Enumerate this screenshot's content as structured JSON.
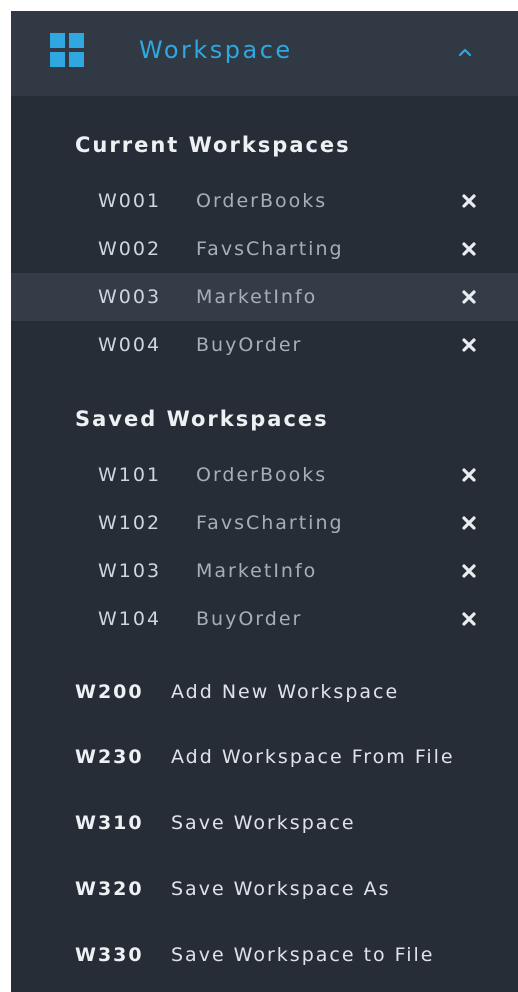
{
  "header": {
    "title": "Workspace",
    "icon": "grid-icon",
    "toggle_icon": "chevron-up-icon",
    "accent": "#2fa7e0"
  },
  "current": {
    "title": "Current Workspaces",
    "items": [
      {
        "id": "W001",
        "name": "OrderBooks"
      },
      {
        "id": "W002",
        "name": "FavsCharting"
      },
      {
        "id": "W003",
        "name": "MarketInfo"
      },
      {
        "id": "W004",
        "name": "BuyOrder"
      }
    ]
  },
  "saved": {
    "title": "Saved Workspaces",
    "items": [
      {
        "id": "W101",
        "name": "OrderBooks"
      },
      {
        "id": "W102",
        "name": "FavsCharting"
      },
      {
        "id": "W103",
        "name": "MarketInfo"
      },
      {
        "id": "W104",
        "name": "BuyOrder"
      }
    ]
  },
  "actions": [
    {
      "id": "W200",
      "label": "Add New Workspace"
    },
    {
      "id": "W230",
      "label": "Add Workspace From File"
    },
    {
      "id": "W310",
      "label": "Save Workspace"
    },
    {
      "id": "W320",
      "label": "Save Workspace As"
    },
    {
      "id": "W330",
      "label": "Save Workspace to File"
    }
  ],
  "colors": {
    "panel_bg": "#262d36",
    "header_bg": "#303944",
    "row_highlight": "#343c47"
  }
}
